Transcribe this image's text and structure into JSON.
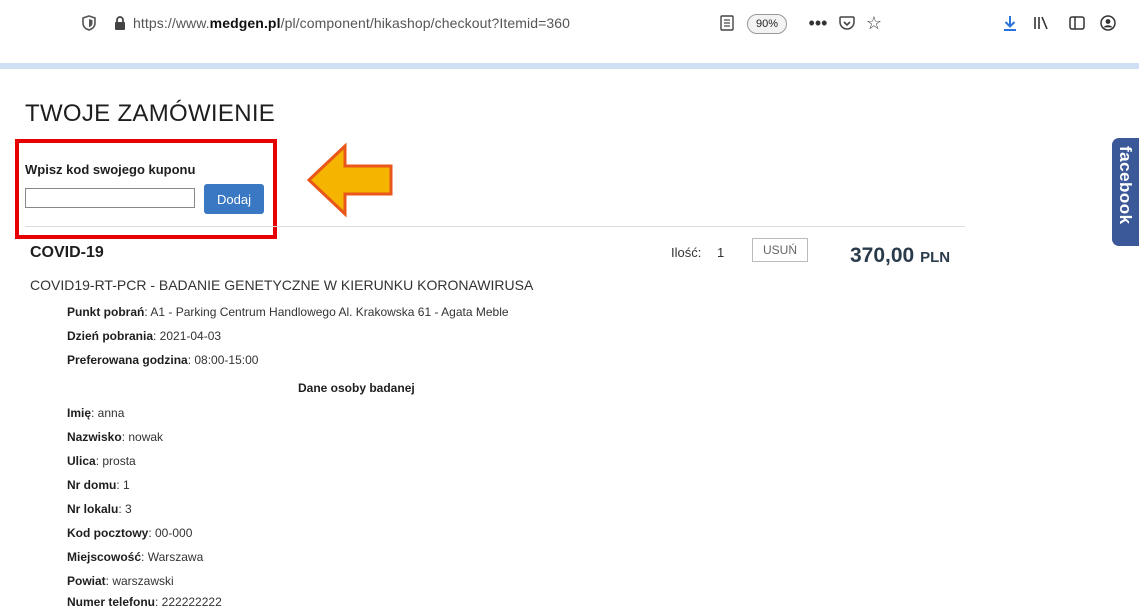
{
  "browser": {
    "url_prefix": "https://www.",
    "url_domain": "medgen.pl",
    "url_path": "/pl/component/hikashop/checkout?Itemid=360",
    "zoom": "90%"
  },
  "page": {
    "title": "TWOJE ZAMÓWIENIE",
    "coupon_label": "Wpisz kod swojego kuponu",
    "coupon_value": "",
    "coupon_button": "Dodaj"
  },
  "cart": {
    "product_name": "COVID-19",
    "qty_label": "Ilość:",
    "qty_value": "1",
    "remove_label": "USUŃ",
    "price_amount": "370,00",
    "price_currency": "PLN",
    "description": "COVID19-RT-PCR - BADANIE GENETYCZNE W KIERUNKU KORONAWIRUSA",
    "details": [
      {
        "label": "Punkt pobrań",
        "value": ": A1 - Parking Centrum Handlowego Al. Krakowska 61 - Agata Meble"
      },
      {
        "label": "Dzień pobrania",
        "value": ": 2021-04-03"
      },
      {
        "label": "Preferowana godzina",
        "value": ": 08:00-15:00"
      }
    ],
    "person_section": "Dane osoby badanej",
    "person": [
      {
        "label": "Imię",
        "value": ": anna"
      },
      {
        "label": "Nazwisko",
        "value": ": nowak"
      },
      {
        "label": "Ulica",
        "value": ": prosta"
      },
      {
        "label": "Nr domu",
        "value": ": 1"
      },
      {
        "label": "Nr lokalu",
        "value": ": 3"
      },
      {
        "label": "Kod pocztowy",
        "value": ": 00-000"
      },
      {
        "label": "Miejscowość",
        "value": ": Warszawa"
      },
      {
        "label": "Powiat",
        "value": ": warszawski"
      },
      {
        "label": "Numer telefonu",
        "value": ": 222222222"
      }
    ]
  },
  "social": {
    "facebook_label": "facebook"
  },
  "annotation": {
    "box_color": "#e60000",
    "arrow_color": "#f5b400"
  },
  "icons": [
    "shield-icon",
    "lock-icon",
    "reader-view-icon",
    "more-icon",
    "pocket-icon",
    "star-icon",
    "download-icon",
    "library-icon",
    "sidebar-icon",
    "account-icon"
  ]
}
